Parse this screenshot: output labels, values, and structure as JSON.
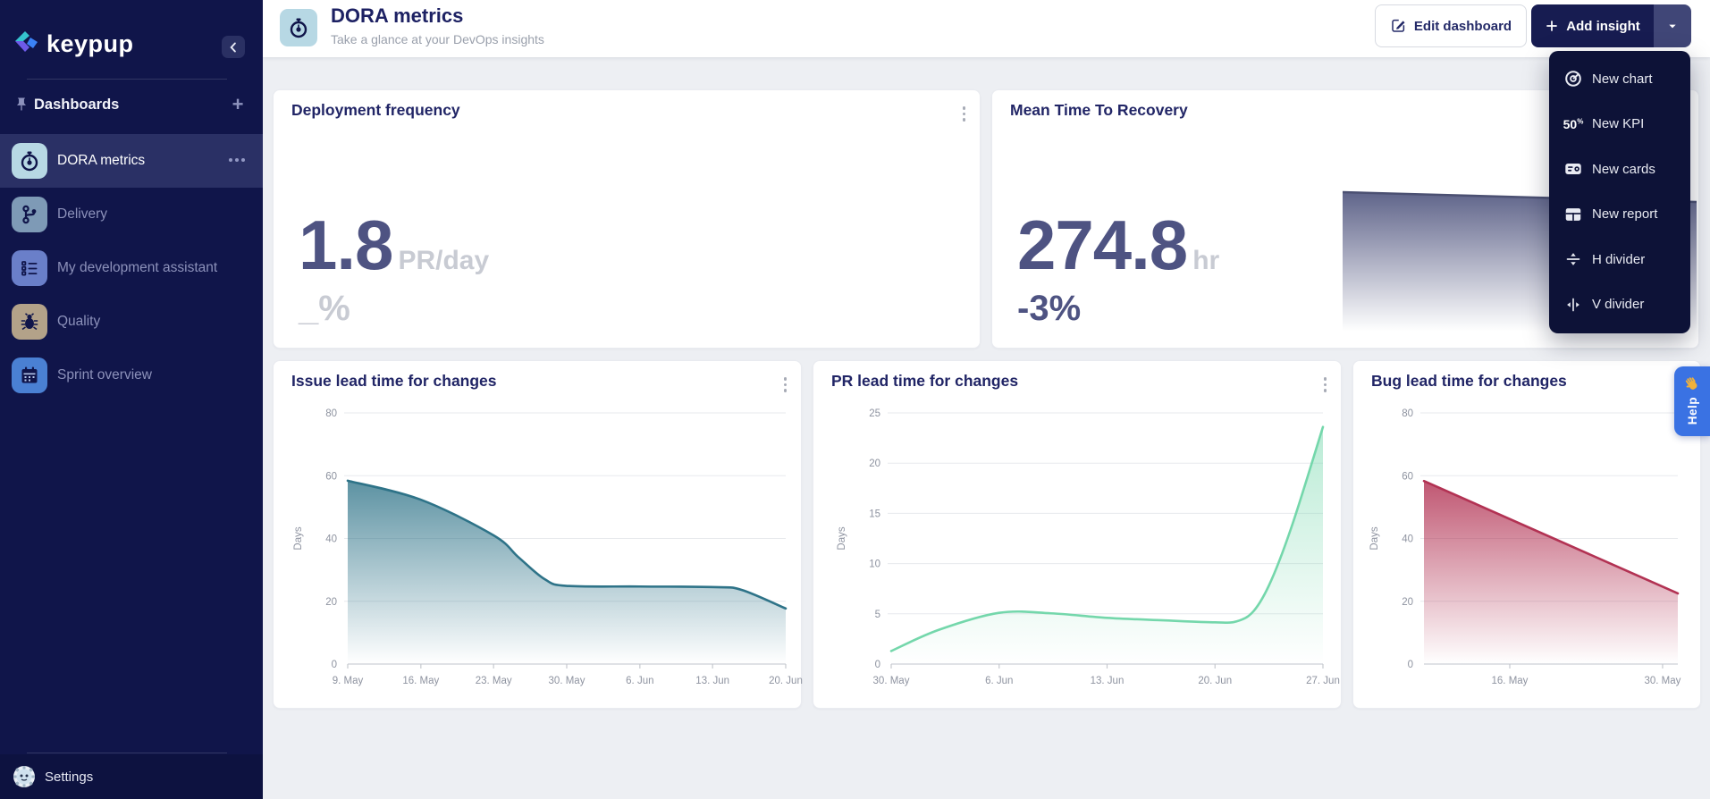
{
  "sidebar": {
    "logo_text": "keypup",
    "collapse_icon": "chevron-left-icon",
    "section": {
      "title": "Dashboards",
      "pin_icon": "pin-icon",
      "add_icon": "plus-icon"
    },
    "items": [
      {
        "label": "DORA metrics",
        "icon": "stopwatch-icon",
        "icon_bg": "#b7d8e4",
        "selected": true,
        "has_menu": true
      },
      {
        "label": "Delivery",
        "icon": "git-branch-icon",
        "icon_bg": "#7e9ab6",
        "selected": false,
        "has_menu": false
      },
      {
        "label": "My development assistant",
        "icon": "checklist-icon",
        "icon_bg": "#6a7fc9",
        "selected": false,
        "has_menu": false
      },
      {
        "label": "Quality",
        "icon": "bug-icon",
        "icon_bg": "#b3a289",
        "selected": false,
        "has_menu": false
      },
      {
        "label": "Sprint overview",
        "icon": "calendar-icon",
        "icon_bg": "#4a80d3",
        "selected": false,
        "has_menu": false
      }
    ],
    "settings_label": "Settings",
    "settings_icon": "gear-avatar-icon"
  },
  "header": {
    "icon": "stopwatch-icon",
    "title": "DORA metrics",
    "subtitle": "Take a glance at your DevOps insights",
    "edit_button": "Edit dashboard",
    "add_button": "Add insight"
  },
  "menu": {
    "items": [
      {
        "label": "New chart",
        "icon": "donut-chart-icon"
      },
      {
        "label": "New KPI",
        "icon": "percent-50-icon"
      },
      {
        "label": "New cards",
        "icon": "cards-icon"
      },
      {
        "label": "New report",
        "icon": "report-table-icon"
      },
      {
        "label": "H divider",
        "icon": "h-divider-icon"
      },
      {
        "label": "V divider",
        "icon": "v-divider-icon"
      }
    ]
  },
  "kpis": [
    {
      "title": "Deployment frequency",
      "value": "1.8",
      "unit": "PR/day",
      "delta": "_%"
    },
    {
      "title": "Mean Time To Recovery",
      "value": "274.8",
      "unit": "hr",
      "delta": "-3%"
    }
  ],
  "help_label": "Help",
  "colors": {
    "sidebar_bg": "#10154a",
    "selected_item_bg": "#2a3065",
    "brand_navy": "#171c51",
    "title_navy": "#212566",
    "kpi_number": "#4e5382",
    "muted_unit": "#c8cbd3",
    "help_blue": "#3a72e3",
    "issue_teal": "#2e7388",
    "pr_mint": "#74d7ab",
    "bug_crimson": "#b23253",
    "spark_slate": "#575c84"
  },
  "chart_data": [
    {
      "type": "area",
      "title": "Issue lead time for changes",
      "xlabel": "",
      "ylabel": "Days",
      "yticks": [
        0,
        20,
        40,
        60,
        80
      ],
      "ylim": [
        0,
        82
      ],
      "grid": true,
      "legend": "none",
      "color": "#2e7388",
      "fill_opacity_top": 0.78,
      "x_ticklabels": [
        "9. May",
        "16. May",
        "23. May",
        "30. May",
        "6. Jun",
        "13. Jun",
        "20. Jun"
      ],
      "tick_fractions": [
        0,
        0.167,
        0.333,
        0.5,
        0.667,
        0.833,
        1
      ],
      "points": [
        [
          0,
          58.4
        ],
        [
          0.166,
          52.4
        ],
        [
          0.333,
          41
        ],
        [
          0.39,
          34
        ],
        [
          0.45,
          27
        ],
        [
          0.5,
          24.9
        ],
        [
          0.667,
          24.7
        ],
        [
          0.84,
          24.5
        ],
        [
          0.9,
          23.6
        ],
        [
          1,
          17.7
        ]
      ]
    },
    {
      "type": "area",
      "title": "PR lead time for changes",
      "xlabel": "",
      "ylabel": "Days",
      "yticks": [
        0,
        5,
        10,
        15,
        20,
        25
      ],
      "ylim": [
        0,
        25.6
      ],
      "grid": true,
      "legend": "none",
      "color": "#74d7ab",
      "fill_opacity_top": 0.5,
      "x_ticklabels": [
        "30. May",
        "6. Jun",
        "13. Jun",
        "20. Jun",
        "27. Jun"
      ],
      "tick_fractions": [
        0,
        0.25,
        0.5,
        0.75,
        1
      ],
      "points": [
        [
          0,
          1.3
        ],
        [
          0.11,
          3.4
        ],
        [
          0.25,
          5.1
        ],
        [
          0.37,
          5.05
        ],
        [
          0.5,
          4.6
        ],
        [
          0.63,
          4.35
        ],
        [
          0.75,
          4.15
        ],
        [
          0.8,
          4.25
        ],
        [
          0.84,
          5.3
        ],
        [
          0.88,
          8.3
        ],
        [
          0.93,
          14
        ],
        [
          1,
          23.6
        ]
      ]
    },
    {
      "type": "area",
      "title": "Bug lead time for changes",
      "xlabel": "",
      "ylabel": "Days",
      "yticks": [
        0,
        20,
        40,
        60,
        80
      ],
      "ylim": [
        0,
        82
      ],
      "grid": true,
      "legend": "none",
      "color": "#b23253",
      "fill_opacity_top": 0.82,
      "x_ticklabels": [
        "16. May",
        "30. May"
      ],
      "tick_fractions": [
        0.338,
        0.94
      ],
      "points": [
        [
          0,
          58.3
        ],
        [
          1,
          22.5
        ]
      ]
    },
    {
      "type": "area",
      "role": "sparkline-of-Mean-Time-To-Recovery",
      "color": "#575c84",
      "points": [
        [
          0,
          100
        ],
        [
          0.25,
          98.8
        ],
        [
          0.5,
          97.6
        ],
        [
          0.75,
          96.4
        ],
        [
          1,
          95.2
        ]
      ]
    }
  ]
}
